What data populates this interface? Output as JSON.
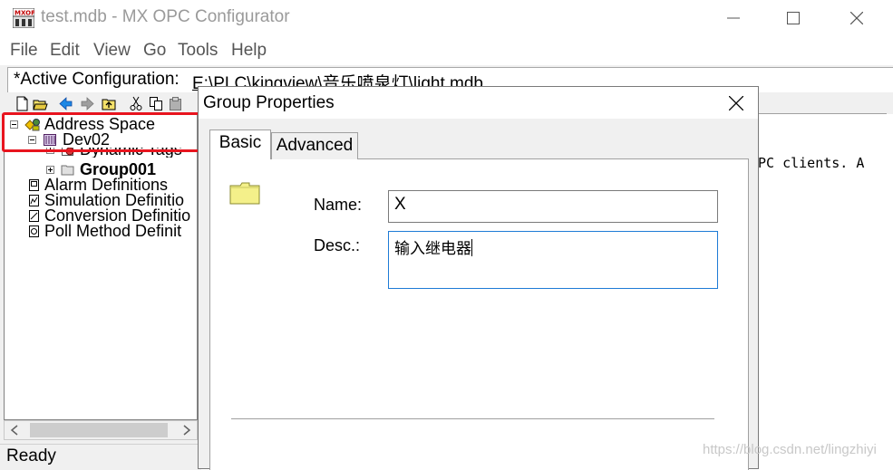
{
  "window": {
    "title": "test.mdb - MX OPC Configurator",
    "icon": "mxopc-app-icon"
  },
  "menu": [
    "File",
    "Edit",
    "View",
    "Go",
    "Tools",
    "Help"
  ],
  "config": {
    "label": "*Active Configuration:",
    "path": "E:\\PLC\\kingview\\音乐喷泉灯\\light.mdb"
  },
  "toolbar": {
    "icons": [
      "new-file-icon",
      "open-folder-icon",
      "back-arrow-icon",
      "forward-arrow-icon",
      "up-folder-icon",
      "cut-icon",
      "copy-icon",
      "paste-icon"
    ]
  },
  "tree": {
    "items": [
      {
        "label": "Address Space",
        "icon": "address-space-icon"
      },
      {
        "label": "Dev02",
        "icon": "device-icon"
      },
      {
        "label": "Dynamic Tags",
        "icon": "dynamic-tags-icon"
      },
      {
        "label": "Group001",
        "icon": "group-icon"
      },
      {
        "label": "Alarm Definitions",
        "icon": "definition-icon"
      },
      {
        "label": "Simulation Definitio",
        "icon": "definition-icon"
      },
      {
        "label": "Conversion Definitio",
        "icon": "definition-icon"
      },
      {
        "label": "Poll Method Definit",
        "icon": "definition-icon"
      }
    ]
  },
  "status": {
    "text": "Ready"
  },
  "background_text": "PC clients. A",
  "dialog": {
    "title": "Group Properties",
    "tabs": [
      {
        "label": "Basic",
        "active": true
      },
      {
        "label": "Advanced",
        "active": false
      }
    ],
    "fields": {
      "name_label": "Name:",
      "name_value": "X",
      "desc_label": "Desc.:",
      "desc_value": "输入继电器"
    }
  },
  "watermark": "https://blog.csdn.net/lingzhiyi",
  "colors": {
    "highlight": "#e8141e",
    "focus_border": "#1e7bd6",
    "folder": "#f4f08a"
  }
}
